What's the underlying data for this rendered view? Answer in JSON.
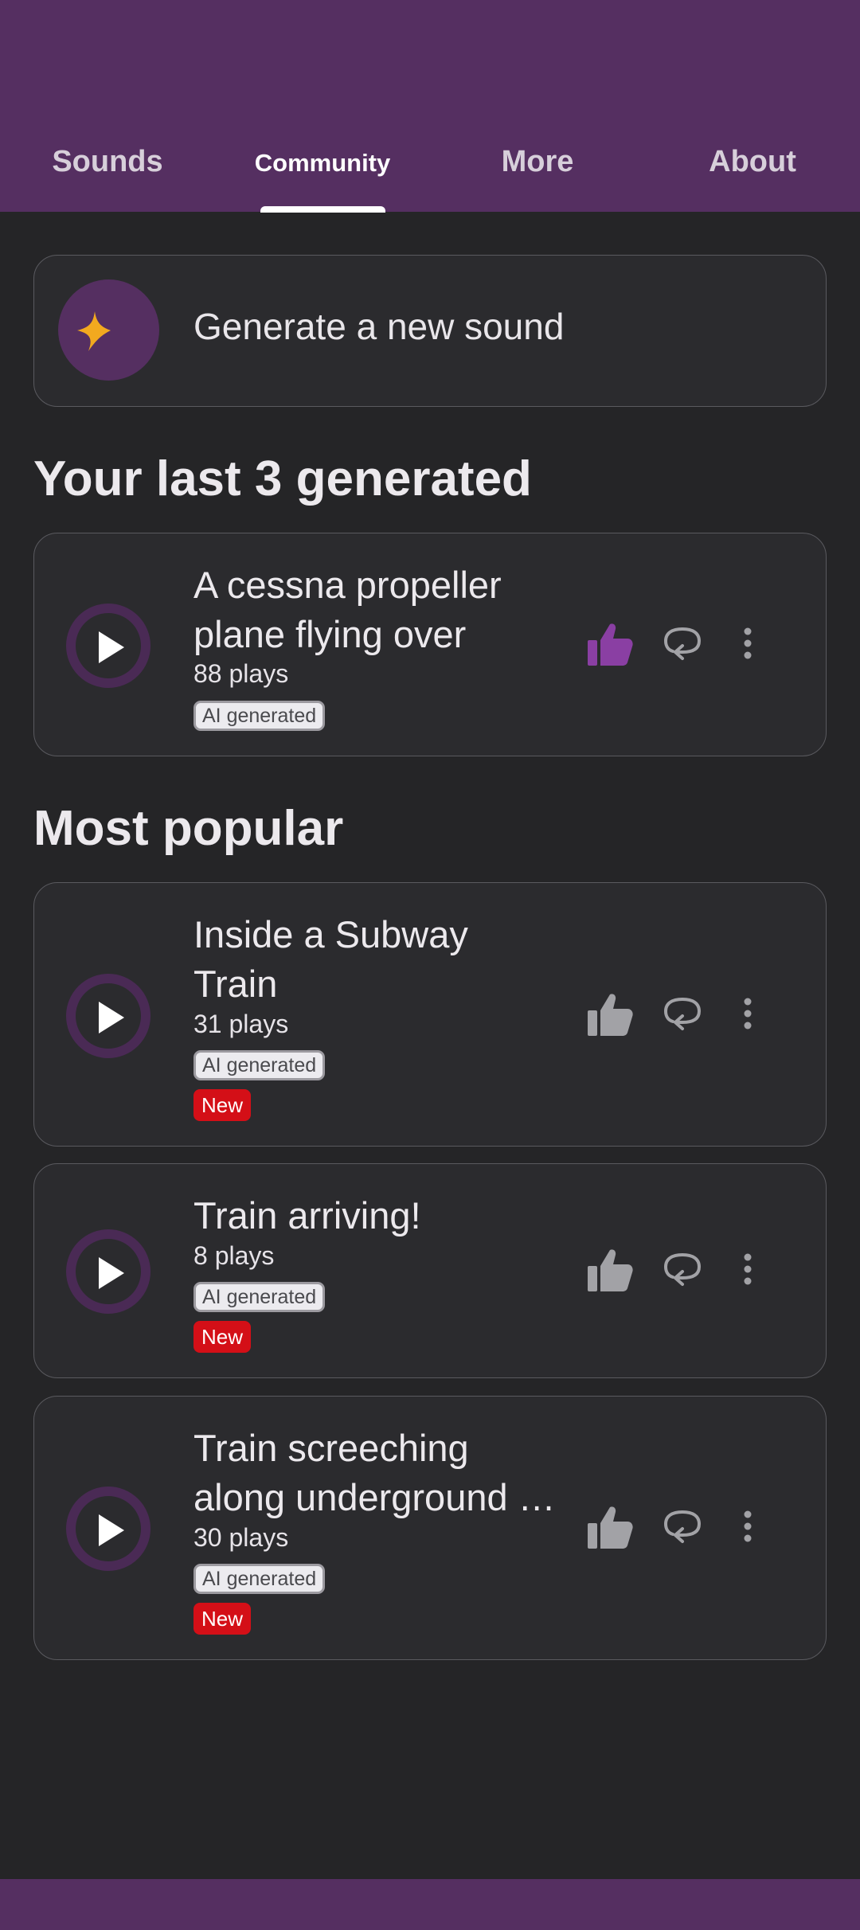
{
  "colors": {
    "brand_purple": "#552f61",
    "background": "#252527",
    "card": "#2b2b2e",
    "like_active": "#8a3fa3",
    "new_badge": "#d40f17",
    "star": "#f2a91f"
  },
  "tabs": [
    {
      "label": "Sounds",
      "active": false
    },
    {
      "label": "Community",
      "active": true
    },
    {
      "label": "More",
      "active": false
    },
    {
      "label": "About",
      "active": false
    }
  ],
  "generate": {
    "label": "Generate a new sound",
    "icon": "sparkle-icon"
  },
  "recent": {
    "title": "Your last 3 generated",
    "items": [
      {
        "title_line1": "A cessna propeller",
        "title_line2": "plane flying over",
        "plays": "88 plays",
        "badge": "AI generated",
        "liked": true
      }
    ]
  },
  "popular": {
    "title": "Most popular",
    "items": [
      {
        "title_line1": "Inside a Subway",
        "title_line2": "Train",
        "plays": "31 plays",
        "badge": "AI generated",
        "new_label": "New",
        "liked": false
      },
      {
        "title_line1": "Train arriving!",
        "plays": "8 plays",
        "badge": "AI generated",
        "new_label": "New",
        "liked": false
      },
      {
        "title_line1": "Train screeching",
        "title_line2": "along underground …",
        "plays": "30 plays",
        "badge": "AI generated",
        "new_label": "New",
        "liked": false
      }
    ]
  },
  "icons": {
    "play": "play-icon",
    "like": "thumbs-up-icon",
    "reply": "reply-icon",
    "more": "more-vertical-icon"
  }
}
